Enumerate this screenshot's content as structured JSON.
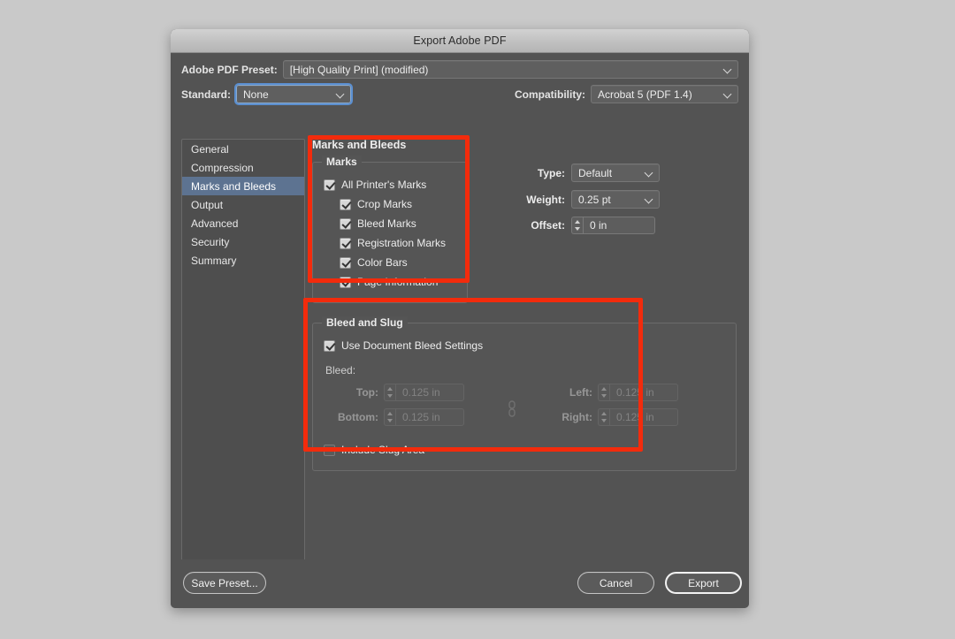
{
  "window": {
    "title": "Export Adobe PDF"
  },
  "header": {
    "preset_label": "Adobe PDF Preset:",
    "preset_value": "[High Quality Print] (modified)",
    "standard_label": "Standard:",
    "standard_value": "None",
    "compatibility_label": "Compatibility:",
    "compatibility_value": "Acrobat 5 (PDF 1.4)"
  },
  "sidebar": {
    "items": [
      {
        "label": "General",
        "selected": false
      },
      {
        "label": "Compression",
        "selected": false
      },
      {
        "label": "Marks and Bleeds",
        "selected": true
      },
      {
        "label": "Output",
        "selected": false
      },
      {
        "label": "Advanced",
        "selected": false
      },
      {
        "label": "Security",
        "selected": false
      },
      {
        "label": "Summary",
        "selected": false
      }
    ]
  },
  "panel": {
    "title": "Marks and Bleeds",
    "marks": {
      "legend": "Marks",
      "items": [
        {
          "label": "All Printer's Marks",
          "checked": true,
          "indent": false
        },
        {
          "label": "Crop Marks",
          "checked": true,
          "indent": true
        },
        {
          "label": "Bleed Marks",
          "checked": true,
          "indent": true
        },
        {
          "label": "Registration Marks",
          "checked": true,
          "indent": true
        },
        {
          "label": "Color Bars",
          "checked": true,
          "indent": true
        },
        {
          "label": "Page Information",
          "checked": true,
          "indent": true
        }
      ],
      "type_label": "Type:",
      "type_value": "Default",
      "weight_label": "Weight:",
      "weight_value": "0.25 pt",
      "offset_label": "Offset:",
      "offset_value": "0 in"
    },
    "bleed": {
      "legend": "Bleed and Slug",
      "use_document_label": "Use Document Bleed Settings",
      "use_document_checked": true,
      "bleed_label": "Bleed:",
      "top_label": "Top:",
      "top_value": "0.125 in",
      "bottom_label": "Bottom:",
      "bottom_value": "0.125 in",
      "left_label": "Left:",
      "left_value": "0.125 in",
      "right_label": "Right:",
      "right_value": "0.125 in",
      "slug_label": "Include Slug Area",
      "slug_checked": false
    }
  },
  "footer": {
    "save_preset": "Save Preset...",
    "cancel": "Cancel",
    "export": "Export"
  },
  "colors": {
    "dialog_bg": "#535353",
    "titlebar": "#c2c2c2",
    "selection": "#5d7391",
    "annotation": "#f32b0c",
    "focus_ring": "#5b8fd0"
  }
}
